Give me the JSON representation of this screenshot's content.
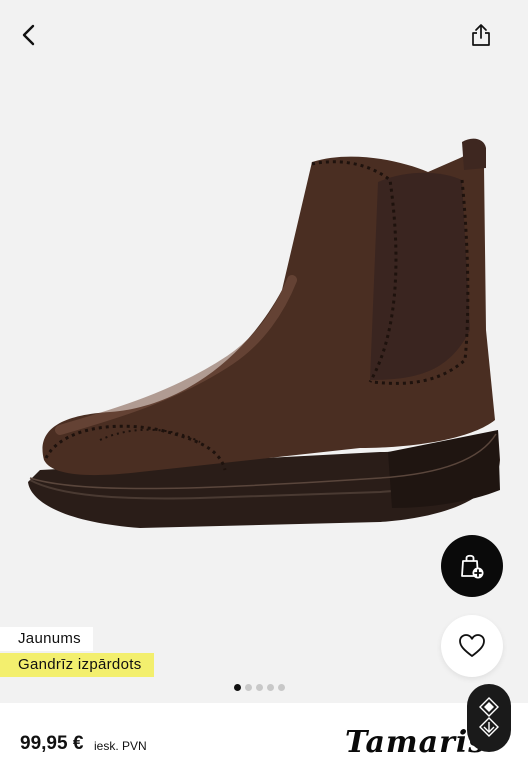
{
  "header": {
    "back_icon": "chevron-left-icon",
    "share_icon": "share-icon"
  },
  "product": {
    "image": "brown-leather-chelsea-boot-brogue",
    "badges": {
      "new": "Jaunums",
      "low_stock": "Gandrīz izpārdots"
    },
    "badge_colors": {
      "low_stock": "#f3ef6e"
    }
  },
  "gallery": {
    "total": 5,
    "active": 1
  },
  "actions": {
    "add_to_cart_icon": "bag-plus-icon",
    "wishlist_icon": "heart-icon",
    "chat_icon": "assistant-icon"
  },
  "footer": {
    "price": "99,95 €",
    "price_note": "iesk. PVN",
    "brand": "Tamaris"
  }
}
